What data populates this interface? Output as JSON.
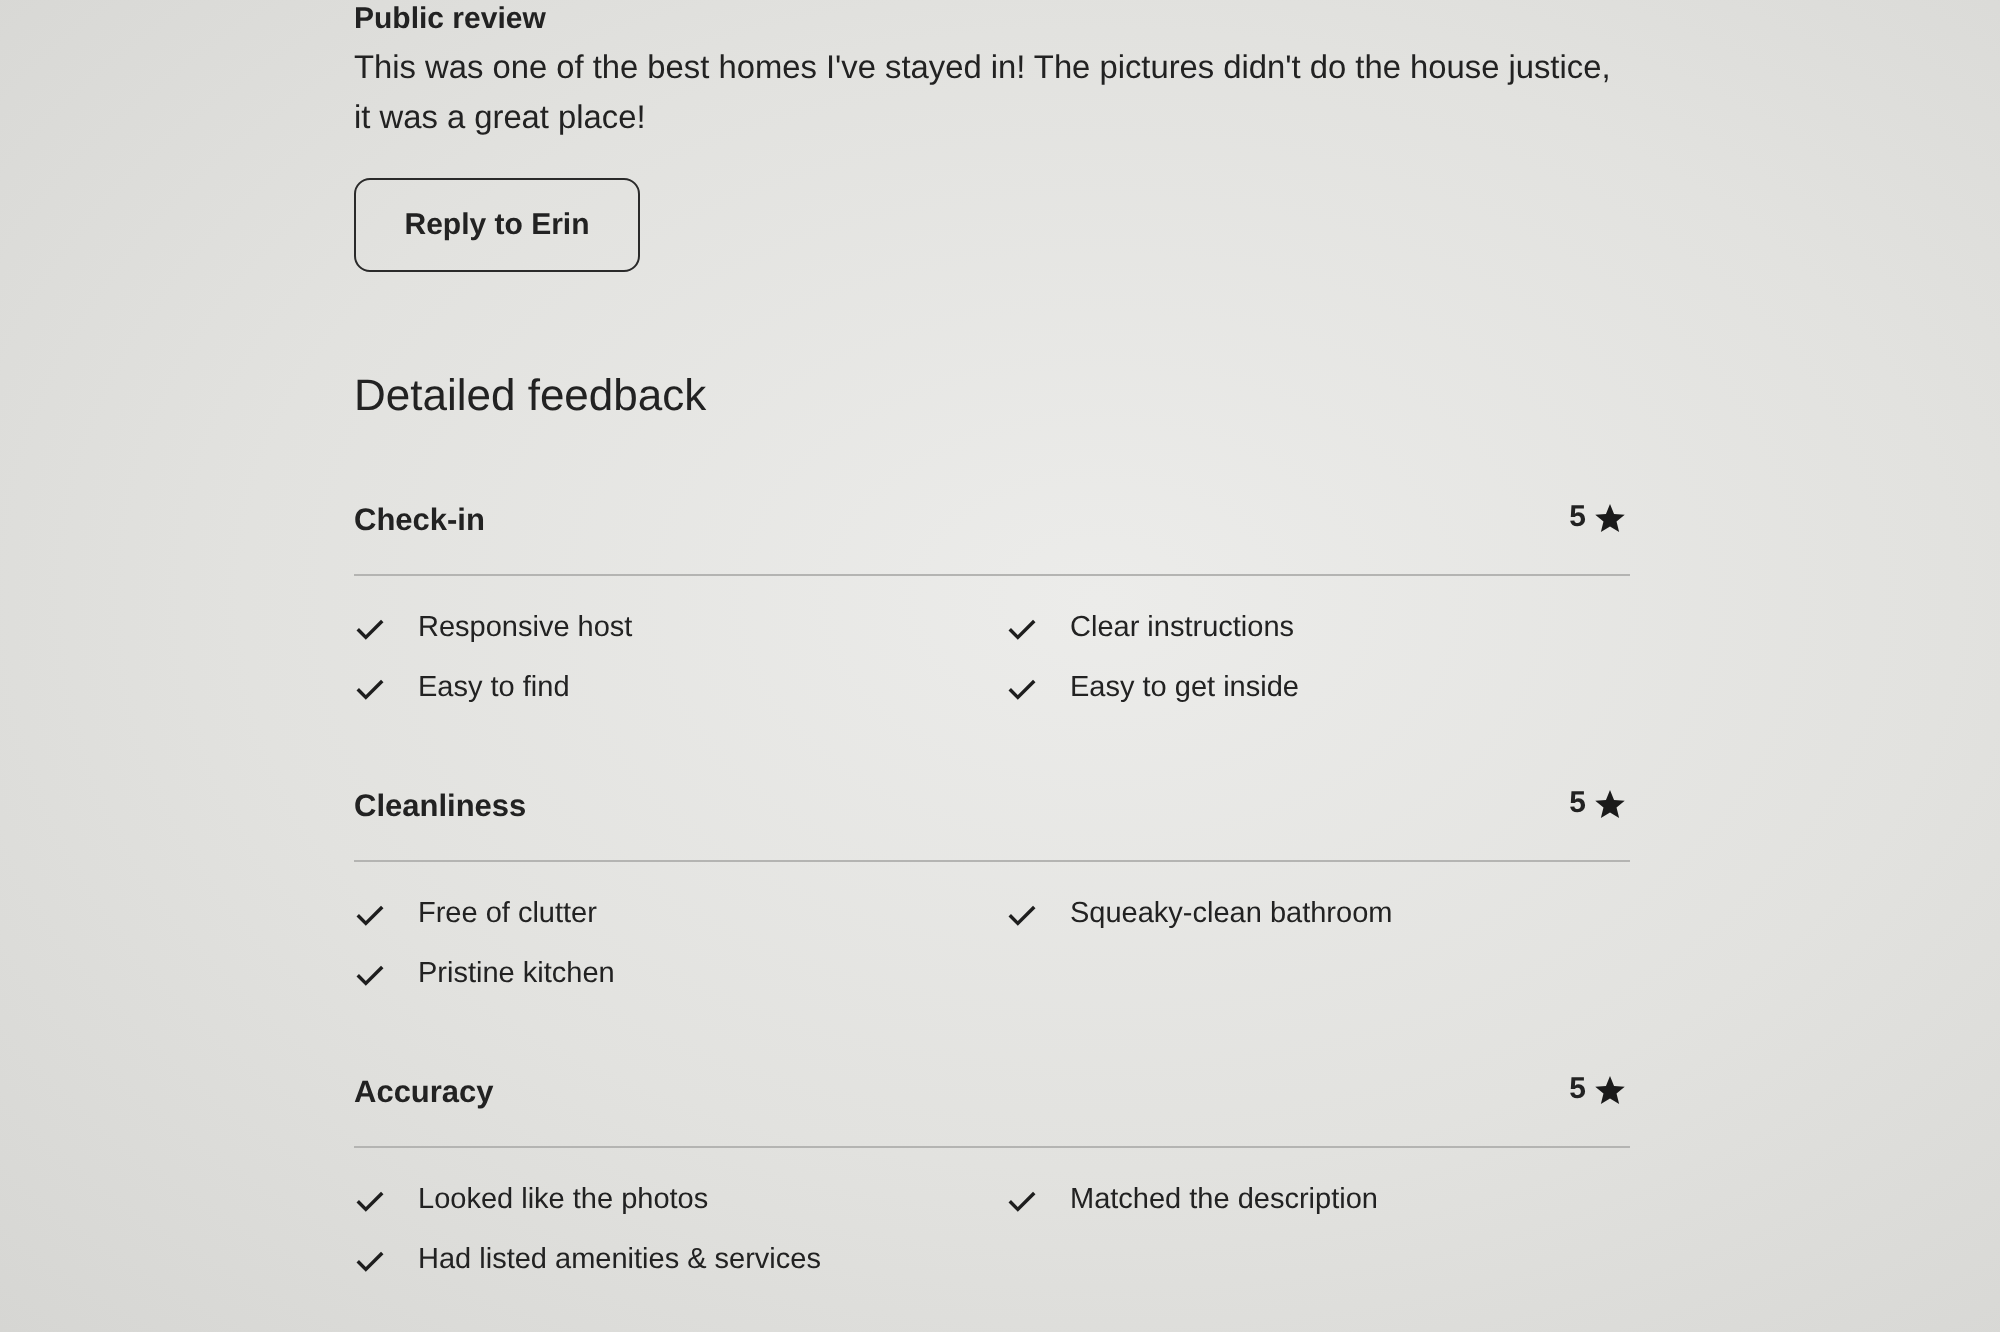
{
  "public_review": {
    "heading": "Public review",
    "text": "This was one of the best homes I've stayed in! The pictures didn't do the house justice, it was a great place!",
    "reply_button": "Reply to Erin"
  },
  "detailed_feedback": {
    "heading": "Detailed feedback",
    "categories": [
      {
        "name": "Check-in",
        "score": "5",
        "tags": [
          "Responsive host",
          "Clear instructions",
          "Easy to find",
          "Easy to get inside"
        ]
      },
      {
        "name": "Cleanliness",
        "score": "5",
        "tags": [
          "Free of clutter",
          "Squeaky-clean bathroom",
          "Pristine kitchen"
        ]
      },
      {
        "name": "Accuracy",
        "score": "5",
        "tags": [
          "Looked like the photos",
          "Matched the description",
          "Had listed amenities & services"
        ]
      }
    ]
  }
}
